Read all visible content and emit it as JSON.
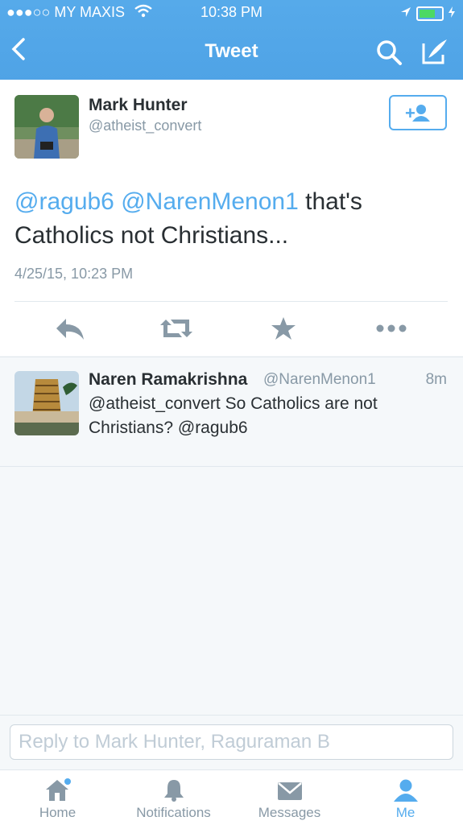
{
  "status_bar": {
    "carrier": "●●●○○ MY MAXIS",
    "time": "10:38 PM"
  },
  "nav": {
    "title": "Tweet",
    "back_icon": "chevron-left-icon"
  },
  "tweet": {
    "author_name": "Mark Hunter",
    "author_handle": "@atheist_convert",
    "mention1": "@ragub6",
    "mention2": "@NarenMenon1",
    "body": "that's Catholics not Christians...",
    "timestamp": "4/25/15, 10:23 PM",
    "actions": [
      "reply-icon",
      "retweet-icon",
      "favorite-icon",
      "more-icon"
    ]
  },
  "reply_tweet": {
    "author_name": "Naren Ramakrishna",
    "author_handle": "@NarenMenon1",
    "time": "8m",
    "text": "@atheist_convert So Catholics are not Christians? @ragub6"
  },
  "composer": {
    "placeholder": "Reply to Mark Hunter, Raguraman B"
  },
  "tabs": [
    {
      "label": "Home",
      "icon": "home-icon"
    },
    {
      "label": "Notifications",
      "icon": "bell-icon"
    },
    {
      "label": "Messages",
      "icon": "envelope-icon"
    },
    {
      "label": "Me",
      "icon": "person-icon",
      "active": true
    }
  ],
  "colors": {
    "accent": "#55acee",
    "navbar": "#55acee",
    "text": "#292f33",
    "muted": "#8899a6"
  }
}
